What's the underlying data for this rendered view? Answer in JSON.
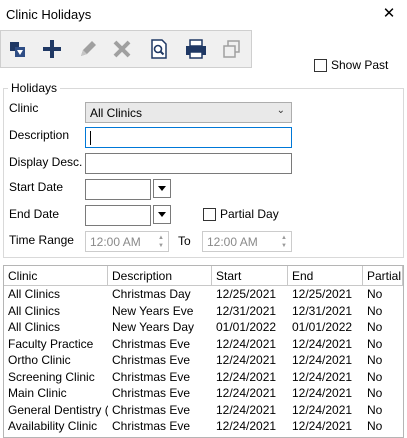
{
  "window": {
    "title": "Clinic Holidays",
    "close_glyph": "✕"
  },
  "toolbar": {
    "buttons": [
      {
        "icon": "refresh-icon"
      },
      {
        "icon": "add-icon"
      },
      {
        "icon": "edit-icon"
      },
      {
        "icon": "delete-icon"
      },
      {
        "icon": "preview-icon"
      },
      {
        "icon": "print-icon"
      },
      {
        "icon": "copy-icon"
      }
    ]
  },
  "show_past": {
    "label": "Show Past",
    "checked": false
  },
  "holidays_group": {
    "legend": "Holidays",
    "clinic": {
      "label": "Clinic",
      "value": "All Clinics"
    },
    "description": {
      "label": "Description",
      "value": ""
    },
    "display_desc": {
      "label": "Display Desc.",
      "value": ""
    },
    "start_date": {
      "label": "Start Date",
      "value": ""
    },
    "end_date": {
      "label": "End Date",
      "value": ""
    },
    "partial_day": {
      "label": "Partial Day",
      "checked": false
    },
    "time_range": {
      "label": "Time Range",
      "from": "12:00 AM",
      "to_label": "To",
      "to": "12:00 AM"
    }
  },
  "table": {
    "columns": [
      "Clinic",
      "Description",
      "Start",
      "End",
      "Partial"
    ],
    "rows": [
      [
        "All Clinics",
        "Christmas Day",
        "12/25/2021",
        "12/25/2021",
        "No"
      ],
      [
        "All Clinics",
        "New Years Eve",
        "12/31/2021",
        "12/31/2021",
        "No"
      ],
      [
        "All Clinics",
        "New Years Day",
        "01/01/2022",
        "01/01/2022",
        "No"
      ],
      [
        "Faculty Practice",
        "Christmas Eve",
        "12/24/2021",
        "12/24/2021",
        "No"
      ],
      [
        "Ortho Clinic",
        "Christmas Eve",
        "12/24/2021",
        "12/24/2021",
        "No"
      ],
      [
        "Screening Clinic",
        "Christmas Eve",
        "12/24/2021",
        "12/24/2021",
        "No"
      ],
      [
        "Main Clinic",
        "Christmas Eve",
        "12/24/2021",
        "12/24/2021",
        "No"
      ],
      [
        "General Dentistry (...",
        "Christmas Eve",
        "12/24/2021",
        "12/24/2021",
        "No"
      ],
      [
        "Availability Clinic",
        "Christmas Eve",
        "12/24/2021",
        "12/24/2021",
        "No"
      ]
    ]
  },
  "colors": {
    "focus_border": "#0078d7",
    "toolbar_bg": "#f0f0f0",
    "icon_navy": "#1f3864",
    "icon_disabled": "#a0a0a0"
  }
}
